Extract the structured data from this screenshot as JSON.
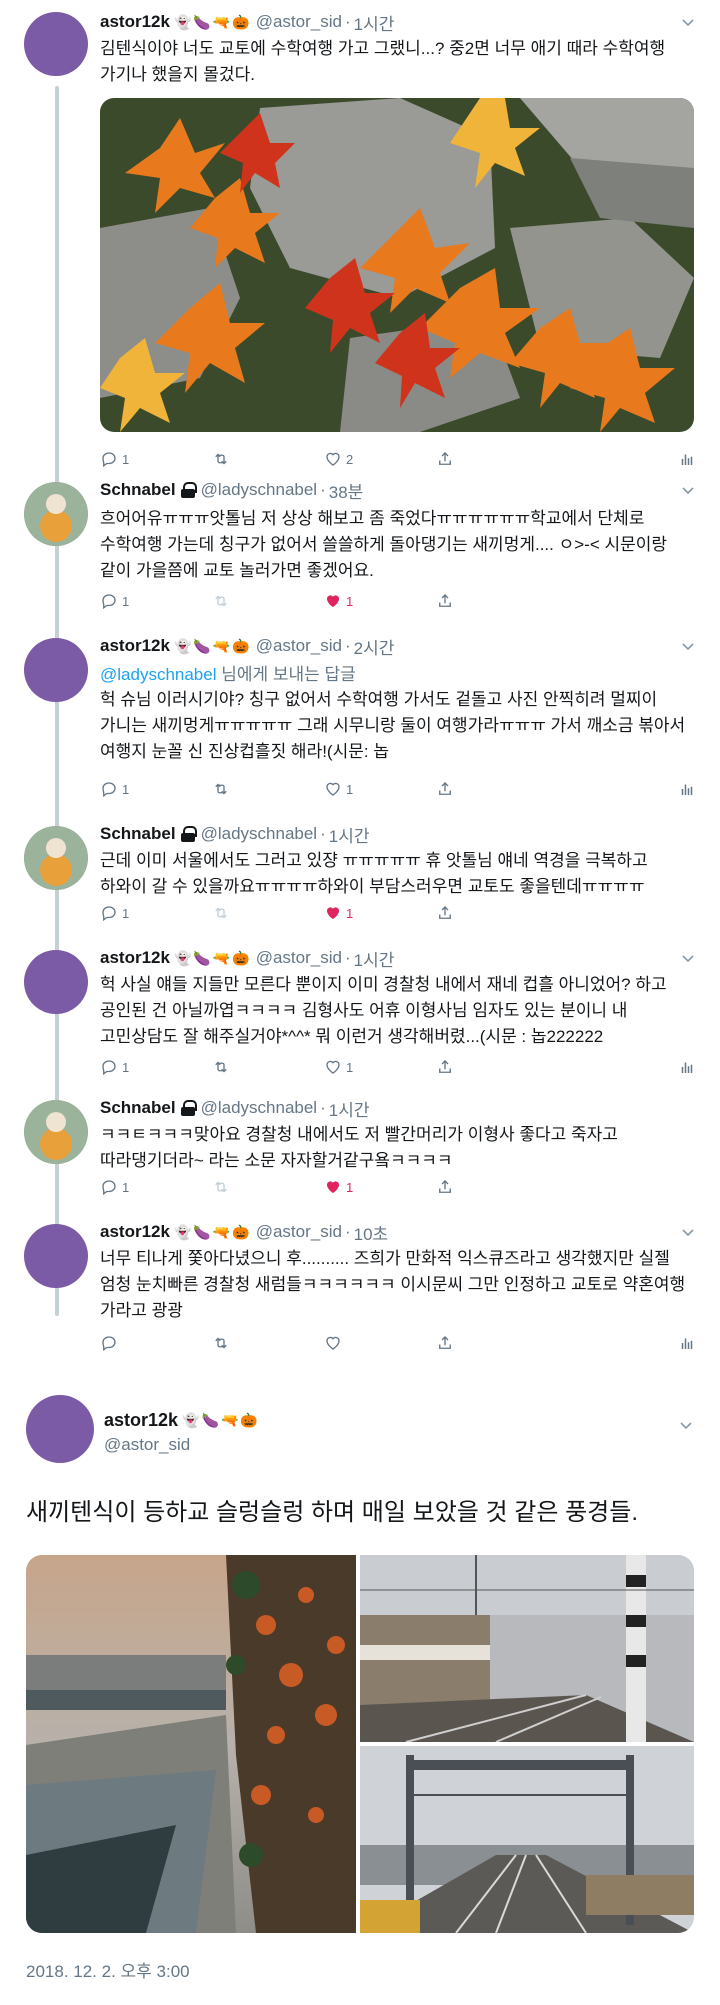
{
  "tweets": [
    {
      "name": "astor12k",
      "emojis": [
        "👻",
        "🍆",
        "🔫",
        "🎃"
      ],
      "handle": "@astor_sid",
      "time": "1시간",
      "text": "김텐식이야 너도 교토에 수학여행 가고 그랬니...? 중2면 너무 애기 때라 수학여행 가기나 했을지 몰겄다.",
      "reply": "1",
      "retweet": "",
      "like": "2"
    },
    {
      "name": "Schnabel",
      "handle": "@ladyschnabel",
      "time": "38분",
      "text": "흐어어유ㅠㅠㅠ앗톨님 저 상상 해보고 좀 죽었다ㅠㅠㅠㅠㅠㅠ학교에서 단체로 수학여행 가는데 칭구가 없어서 쓸쓸하게 돌아댕기는 새끼멍게.... ㅇ>-< 시문이랑 같이 가을쯤에 교토 놀러가면 좋겠어요.",
      "reply": "1",
      "retweet": "",
      "like": "1"
    },
    {
      "name": "astor12k",
      "emojis": [
        "👻",
        "🍆",
        "🔫",
        "🎃"
      ],
      "handle": "@astor_sid",
      "time": "2시간",
      "replying_to": "@ladyschnabel",
      "replying_suffix": " 님에게 보내는 답글",
      "text": "헉 슈님 이러시기야? 칭구 없어서 수학여행 가서도 겉돌고 사진 안찍히려 멀찌이 가니는 새끼멍게ㅠㅠㅠㅠㅠ 그래 시무니랑 둘이 여행가라ㅠㅠㅠ 가서 깨소금 볶아서 여행지 눈꼴 신 진상컵흘짓 해라!(시문: 놉",
      "reply": "1",
      "retweet": "",
      "like": "1"
    },
    {
      "name": "Schnabel",
      "handle": "@ladyschnabel",
      "time": "1시간",
      "text": "근데 이미 서울에서도 그러고 있쟝 ㅠㅠㅠㅠㅠ 휴 앗톨님 얘네 역경을 극복하고 하와이 갈 수 있을까요ㅠㅠㅠㅠ하와이 부담스러우면 교토도 좋을텐데ㅠㅠㅠㅠ",
      "reply": "1",
      "retweet": "",
      "like": "1"
    },
    {
      "name": "astor12k",
      "emojis": [
        "👻",
        "🍆",
        "🔫",
        "🎃"
      ],
      "handle": "@astor_sid",
      "time": "1시간",
      "text": "헉 사실 얘들 지들만 모른다 뿐이지 이미 경찰청 내에서 재네 컵흘 아니었어? 하고 공인된 건 아닐까엽ㅋㅋㅋㅋ 김형사도 어휴 이형사님 임자도 있는 분이니 내 고민상담도 잘 해주실거야*^^* 뭐 이런거 생각해버렸...(시문 : 놉222222",
      "reply": "1",
      "retweet": "",
      "like": "1"
    },
    {
      "name": "Schnabel",
      "handle": "@ladyschnabel",
      "time": "1시간",
      "text": "ㅋㅋㅌㅋㅋㅋ맞아요 경찰청 내에서도 저 빨간머리가 이형사 좋다고 죽자고 따라댕기더라~ 라는 소문 자자할거같구욬ㅋㅋㅋㅋ",
      "reply": "1",
      "retweet": "",
      "like": "1"
    },
    {
      "name": "astor12k",
      "emojis": [
        "👻",
        "🍆",
        "🔫",
        "🎃"
      ],
      "handle": "@astor_sid",
      "time": "10초",
      "text": "너무 티나게 쫓아다녔으니 후.......... 즈희가 만화적 익스큐즈라고 생각했지만 실젤 엄청 눈치빠른 경찰청 새럼들ㅋㅋㅋㅋㅋㅋ 이시문씨 그만 인정하고 교토로 약혼여행 가라고 광광",
      "reply": "",
      "retweet": "",
      "like": ""
    }
  ],
  "main": {
    "name": "astor12k",
    "emojis": [
      "👻",
      "🍆",
      "🔫",
      "🎃"
    ],
    "handle": "@astor_sid",
    "text": "새끼텐식이 등하교 슬렁슬렁 하며 매일 보았을 것 같은 풍경들.",
    "timestamp": "2018. 12. 2. 오후 3:00"
  },
  "colors": {
    "accent": "#1da1f2",
    "like": "#e0245e",
    "muted": "#657786",
    "avatar_astor": "#7b5aa6"
  },
  "icons": [
    "reply-icon",
    "retweet-icon",
    "like-icon",
    "share-icon",
    "stats-icon",
    "lock-icon",
    "caret-down-icon"
  ]
}
